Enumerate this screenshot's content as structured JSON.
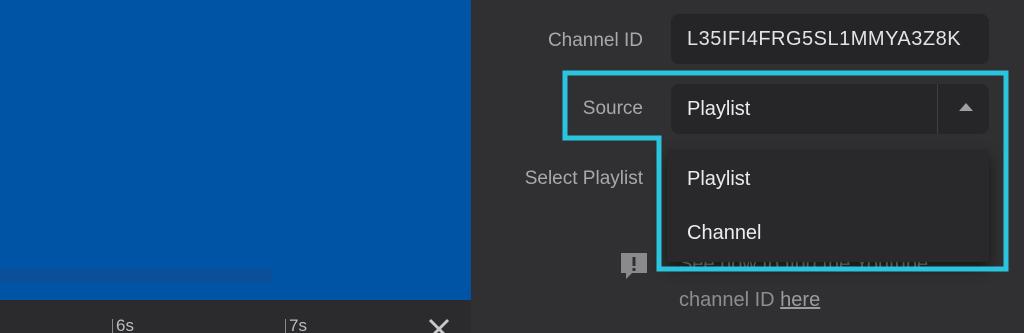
{
  "preview": {
    "timeline": {
      "ticks": [
        "6s",
        "7s"
      ]
    }
  },
  "settings": {
    "channel_id": {
      "label": "Channel ID",
      "value": "L35IFI4FRG5SL1MMYA3Z8K"
    },
    "source": {
      "label": "Source",
      "selected": "Playlist",
      "options": [
        "Playlist",
        "Channel"
      ]
    },
    "select_playlist": {
      "label": "Select Playlist"
    },
    "hint": {
      "line1": "See how to find the Youtube",
      "line2_prefix": "channel ID ",
      "link_text": "here"
    }
  },
  "colors": {
    "highlight": "#2bc4de",
    "preview_bg": "#0054a5"
  }
}
